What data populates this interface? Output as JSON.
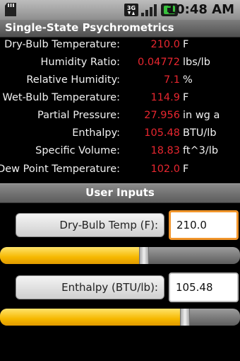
{
  "status_bar": {
    "time": "10:48 AM",
    "network_label": "3G"
  },
  "title": "Single-State Psychrometrics",
  "results": [
    {
      "label": "Dry-Bulb Temperature:",
      "value": "210.0",
      "unit": "F"
    },
    {
      "label": "Humidity Ratio:",
      "value": "0.04772",
      "unit": "lbs/lb"
    },
    {
      "label": "Relative Humidity:",
      "value": "7.1",
      "unit": "%"
    },
    {
      "label": "Wet-Bulb Temperature:",
      "value": "114.9",
      "unit": "F"
    },
    {
      "label": "Partial Pressure:",
      "value": "27.956",
      "unit": "in wg a"
    },
    {
      "label": "Enthalpy:",
      "value": "105.48",
      "unit": "BTU/lb"
    },
    {
      "label": "Specific Volume:",
      "value": "18.83",
      "unit": "ft^3/lb"
    },
    {
      "label": "Dew Point Temperature:",
      "value": "102.0",
      "unit": "F"
    }
  ],
  "inputs_header": "User Inputs",
  "inputs": {
    "dry_bulb": {
      "label": "Dry-Bulb Temp (F):",
      "value": "210.0",
      "slider_fraction": 0.6
    },
    "enthalpy": {
      "label": "Enthalpy (BTU/lb):",
      "value": "105.48",
      "slider_fraction": 0.77
    }
  },
  "colors": {
    "value_text": "#e8262f",
    "slider_fill": "#f6b800",
    "focus_border": "#f1952b"
  }
}
